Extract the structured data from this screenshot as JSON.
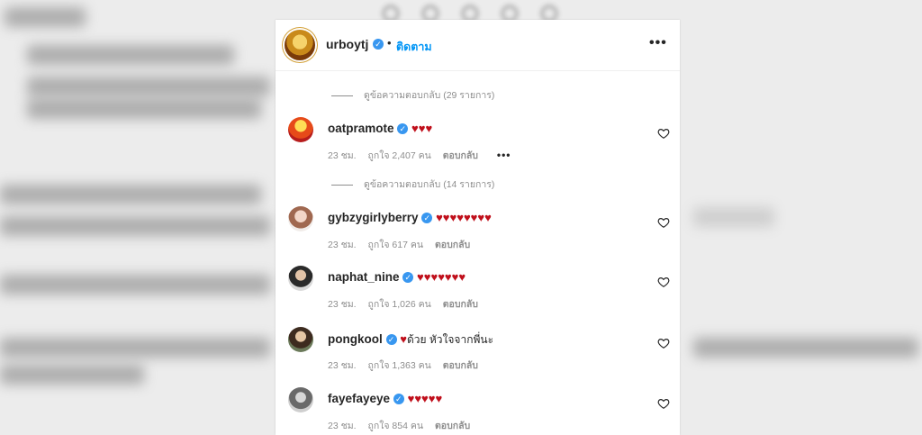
{
  "post": {
    "username": "urboytj",
    "follow_label": "ติดตาม",
    "dot": "•",
    "more_label": "•••"
  },
  "comments": [
    {
      "view_replies_above": "ดูข้อความตอบกลับ (29 รายการ)",
      "username": "oatpramote",
      "text": "",
      "hearts": "♥♥♥",
      "time": "23 ชม.",
      "likes": "ถูกใจ 2,407 คน",
      "reply": "ตอบกลับ",
      "more": "•••"
    },
    {
      "view_replies_above": "ดูข้อความตอบกลับ (14 รายการ)",
      "username": "gybzygirlyberry",
      "text": "",
      "hearts": "♥♥♥♥♥♥♥♥",
      "time": "23 ชม.",
      "likes": "ถูกใจ 617 คน",
      "reply": "ตอบกลับ"
    },
    {
      "username": "naphat_nine",
      "text": "",
      "hearts": "♥♥♥♥♥♥♥",
      "time": "23 ชม.",
      "likes": "ถูกใจ 1,026 คน",
      "reply": "ตอบกลับ"
    },
    {
      "username": "pongkool",
      "hearts": "♥",
      "text": "ด้วย หัวใจจากพี่นะ",
      "time": "23 ชม.",
      "likes": "ถูกใจ 1,363 คน",
      "reply": "ตอบกลับ"
    },
    {
      "username": "fayefayeye",
      "text": "",
      "hearts": "♥♥♥♥♥",
      "time": "23 ชม.",
      "likes": "ถูกใจ 854 คน",
      "reply": "ตอบกลับ"
    }
  ],
  "colors": {
    "link_blue": "#0095f6",
    "verified_blue": "#3897f0",
    "heart_red": "#c00f1b",
    "muted_text": "#8e8e8e"
  },
  "icons": [
    "verified-badge-icon",
    "like-heart-icon",
    "more-options-icon"
  ]
}
